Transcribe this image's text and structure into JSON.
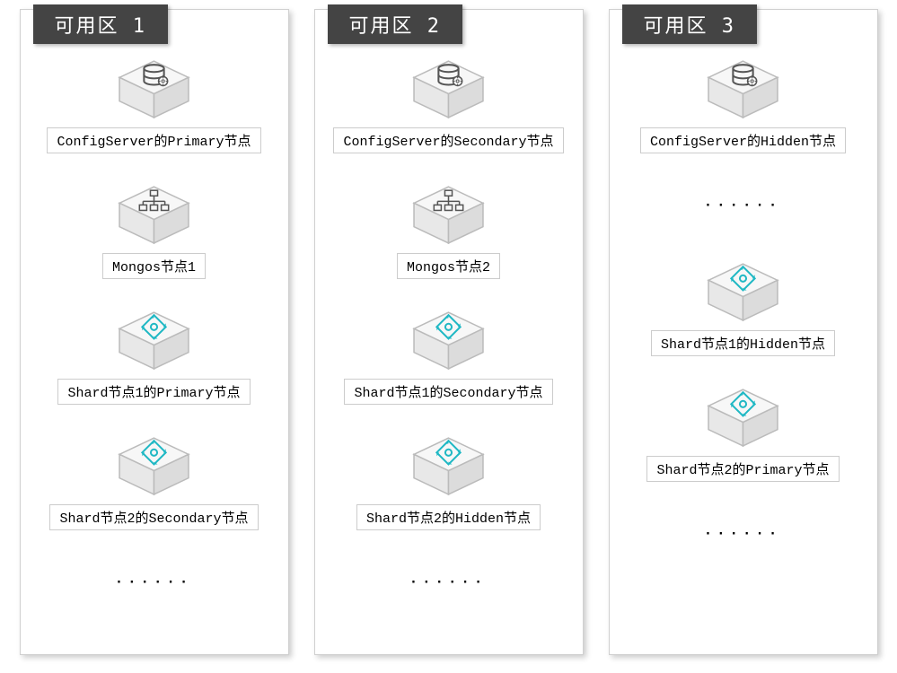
{
  "zones": [
    {
      "title": "可用区 1",
      "nodes": [
        {
          "icon": "db",
          "label": "ConfigServer的Primary节点"
        },
        {
          "icon": "tree",
          "label": "Mongos节点1"
        },
        {
          "icon": "shard",
          "label": "Shard节点1的Primary节点"
        },
        {
          "icon": "shard",
          "label": "Shard节点2的Secondary节点"
        }
      ],
      "ellipsis_after": true,
      "ellipsis_at": null
    },
    {
      "title": "可用区 2",
      "nodes": [
        {
          "icon": "db",
          "label": "ConfigServer的Secondary节点"
        },
        {
          "icon": "tree",
          "label": "Mongos节点2"
        },
        {
          "icon": "shard",
          "label": "Shard节点1的Secondary节点"
        },
        {
          "icon": "shard",
          "label": "Shard节点2的Hidden节点"
        }
      ],
      "ellipsis_after": true,
      "ellipsis_at": null
    },
    {
      "title": "可用区 3",
      "nodes": [
        {
          "icon": "db",
          "label": "ConfigServer的Hidden节点"
        },
        {
          "icon": "shard",
          "label": "Shard节点1的Hidden节点"
        },
        {
          "icon": "shard",
          "label": "Shard节点2的Primary节点"
        }
      ],
      "ellipsis_after": true,
      "ellipsis_at": 1
    }
  ],
  "ellipsis_text": "······"
}
